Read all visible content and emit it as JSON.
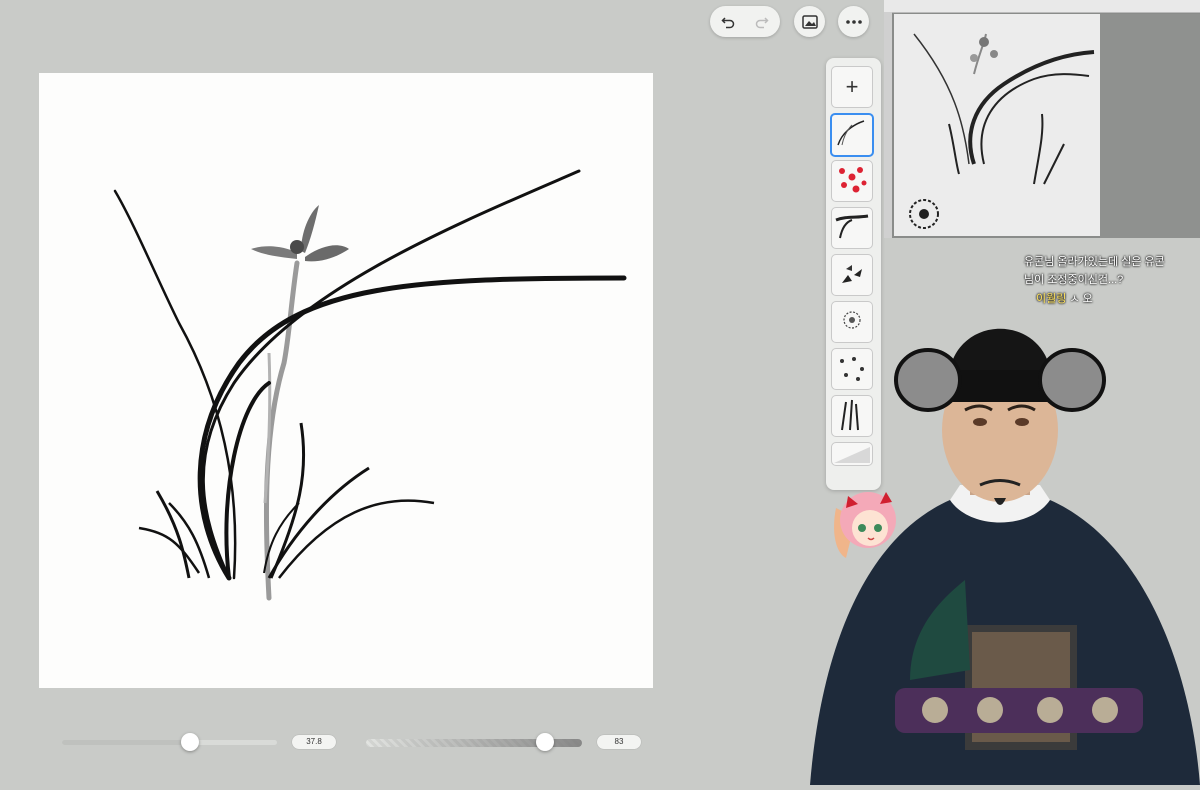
{
  "toolbar": {
    "undo_icon": "undo-icon",
    "redo_icon": "redo-icon",
    "gallery_icon": "image-icon",
    "more_icon": "more-icon"
  },
  "brush_panel": {
    "add_label": "+",
    "brushes": [
      "orchid-leaf",
      "red-dots",
      "pine-branch",
      "scatter-leaf",
      "chrysanthemum",
      "small-scatter",
      "grass-stroke",
      "ink-smear"
    ],
    "selected_index": 0
  },
  "sliders": {
    "size_value": "37.8",
    "size_level": 0.58,
    "opacity_value": "83",
    "opacity_level": 0.83
  },
  "chat": {
    "line1": "유콘님 올라가있는데 실은 유콘",
    "line2": "님이 조정중이신건...?",
    "line3_name": "이월링",
    "line3_msg": "ㅅ 오"
  },
  "colors": {
    "background": "#c9cbc8",
    "canvas": "#fdfdfc",
    "accent": "#3a8ef0",
    "ink": "#111111"
  }
}
